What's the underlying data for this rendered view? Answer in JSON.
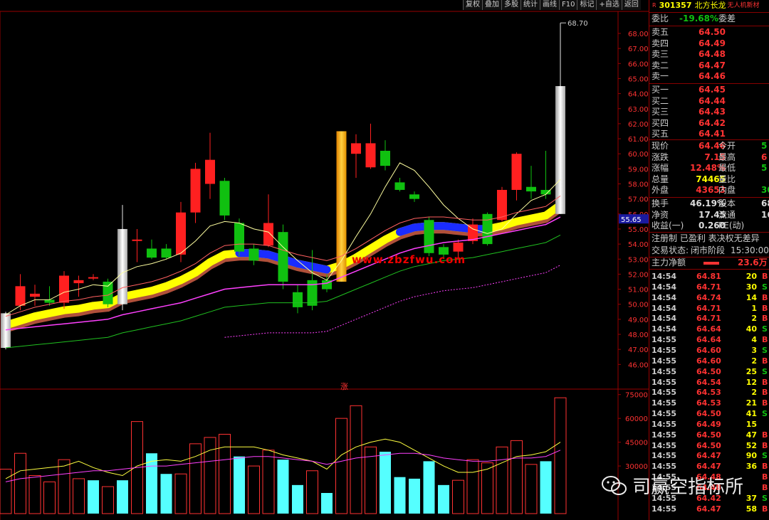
{
  "toolbar": [
    "复权",
    "叠加",
    "多股",
    "统计",
    "画线",
    "F10",
    "标记",
    "+自选",
    "返回"
  ],
  "stock": {
    "tag": "R",
    "code": "301357",
    "name": "北方长龙",
    "industry": "无人机新材"
  },
  "price_axis": {
    "ticks": [
      "68.00",
      "67.00",
      "66.00",
      "65.00",
      "64.00",
      "63.00",
      "62.00",
      "61.00",
      "60.00",
      "59.00",
      "58.00",
      "57.00",
      "56.00",
      "55.00",
      "54.00",
      "53.00",
      "52.00",
      "51.00",
      "50.00",
      "49.00",
      "48.00",
      "47.00",
      "46.00"
    ],
    "current": "55.65",
    "high_label": "68.70"
  },
  "volume_axis": {
    "ticks": [
      "75000",
      "60000",
      "45000",
      "30000"
    ]
  },
  "overlay": {
    "site": "www.zbzfwu.com",
    "limit_up_mark": "涨"
  },
  "watermark": {
    "text": "司赢空指标所"
  },
  "quote": {
    "weibi_label": "委比",
    "weibi_value": "-19.68%",
    "weicha_label": "委差",
    "asks": [
      {
        "label": "卖五",
        "price": "64.50"
      },
      {
        "label": "卖四",
        "price": "64.49"
      },
      {
        "label": "卖三",
        "price": "64.48"
      },
      {
        "label": "卖二",
        "price": "64.47"
      },
      {
        "label": "卖一",
        "price": "64.46"
      }
    ],
    "bids": [
      {
        "label": "买一",
        "price": "64.45"
      },
      {
        "label": "买二",
        "price": "64.44"
      },
      {
        "label": "买三",
        "price": "64.43"
      },
      {
        "label": "买四",
        "price": "64.42"
      },
      {
        "label": "买五",
        "price": "64.41"
      }
    ],
    "stats": [
      {
        "l1": "现价",
        "v1": "64.46",
        "c1": "red",
        "l2": "今开",
        "v2": "5",
        "c2": "green"
      },
      {
        "l1": "涨跌",
        "v1": "7.15",
        "c1": "red",
        "l2": "最高",
        "v2": "6",
        "c2": "red"
      },
      {
        "l1": "涨幅",
        "v1": "12.48%",
        "c1": "red",
        "l2": "最低",
        "v2": "5",
        "c2": "green"
      },
      {
        "l1": "总量",
        "v1": "74465",
        "c1": "yellow",
        "l2": "量比",
        "v2": "",
        "c2": "white"
      },
      {
        "l1": "外盘",
        "v1": "43653",
        "c1": "red",
        "l2": "内盘",
        "v2": "30",
        "c2": "green"
      }
    ],
    "stats2": [
      {
        "l1": "换手",
        "v1": "46.19%",
        "c1": "white",
        "l2": "股本",
        "v2": "68",
        "c2": "white"
      },
      {
        "l1": "净资",
        "v1": "17.45",
        "c1": "white",
        "l2": "流通",
        "v2": "16",
        "c2": "white"
      },
      {
        "l1": "收益(一)",
        "v1": "0.260",
        "c1": "white",
        "l2": "PE(动)",
        "v2": "",
        "c2": "white"
      }
    ],
    "registration": "注册制 已盈利 表决权无差异",
    "trade_status_label": "交易状态:",
    "trade_status": "闭市阶段",
    "trade_time": "15:30:00",
    "main_flow_label": "主力净额",
    "main_flow_value": "23.6万"
  },
  "ticks": [
    {
      "time": "14:54",
      "price": "64.81",
      "vol": "20",
      "dir": "B"
    },
    {
      "time": "14:54",
      "price": "64.71",
      "vol": "30",
      "dir": "S"
    },
    {
      "time": "14:54",
      "price": "64.74",
      "vol": "14",
      "dir": "B"
    },
    {
      "time": "14:54",
      "price": "64.71",
      "vol": "1",
      "dir": "B"
    },
    {
      "time": "14:54",
      "price": "64.71",
      "vol": "2",
      "dir": "B"
    },
    {
      "time": "14:54",
      "price": "64.64",
      "vol": "40",
      "dir": "S"
    },
    {
      "time": "14:55",
      "price": "64.64",
      "vol": "4",
      "dir": "B"
    },
    {
      "time": "14:55",
      "price": "64.60",
      "vol": "3",
      "dir": "S"
    },
    {
      "time": "14:55",
      "price": "64.60",
      "vol": "2",
      "dir": "B"
    },
    {
      "time": "14:55",
      "price": "64.50",
      "vol": "25",
      "dir": "S"
    },
    {
      "time": "14:55",
      "price": "64.54",
      "vol": "12",
      "dir": "B"
    },
    {
      "time": "14:55",
      "price": "64.53",
      "vol": "2",
      "dir": "B"
    },
    {
      "time": "14:55",
      "price": "64.53",
      "vol": "21",
      "dir": "B"
    },
    {
      "time": "14:55",
      "price": "64.50",
      "vol": "41",
      "dir": "S"
    },
    {
      "time": "14:55",
      "price": "64.49",
      "vol": "15",
      "dir": ""
    },
    {
      "time": "14:55",
      "price": "64.50",
      "vol": "47",
      "dir": "B"
    },
    {
      "time": "14:55",
      "price": "64.50",
      "vol": "52",
      "dir": "B"
    },
    {
      "time": "14:55",
      "price": "64.47",
      "vol": "90",
      "dir": "S"
    },
    {
      "time": "14:55",
      "price": "64.47",
      "vol": "36",
      "dir": "B"
    },
    {
      "time": "14:55",
      "price": "64.48",
      "vol": "",
      "dir": "B"
    },
    {
      "time": "14:55",
      "price": "64.48",
      "vol": "",
      "dir": "B"
    },
    {
      "time": "14:55",
      "price": "64.42",
      "vol": "37",
      "dir": "S"
    },
    {
      "time": "14:55",
      "price": "64.47",
      "vol": "58",
      "dir": "B"
    }
  ],
  "colors": {
    "up": "#ff3232",
    "down": "#10c010",
    "volume_cyan": "#55ffff",
    "ma_yellow": "#ffff00",
    "ma_magenta": "#ff40ff",
    "band_blue": "#1a2cff"
  },
  "chart_data": {
    "type": "candlestick",
    "candles": [
      {
        "o": 47.1,
        "c": 49.4,
        "h": 49.5,
        "l": 47.0,
        "color": "white"
      },
      {
        "o": 49.9,
        "c": 51.2,
        "h": 52.0,
        "l": 49.6,
        "color": "red"
      },
      {
        "o": 50.5,
        "c": 50.7,
        "h": 51.3,
        "l": 49.9,
        "color": "red"
      },
      {
        "o": 50.1,
        "c": 50.3,
        "h": 51.2,
        "l": 49.9,
        "color": "green"
      },
      {
        "o": 50.1,
        "c": 51.9,
        "h": 52.2,
        "l": 49.7,
        "color": "red"
      },
      {
        "o": 51.4,
        "c": 51.6,
        "h": 51.9,
        "l": 50.5,
        "color": "red"
      },
      {
        "o": 51.8,
        "c": 51.8,
        "h": 52.0,
        "l": 51.6,
        "color": "red"
      },
      {
        "o": 51.5,
        "c": 50.0,
        "h": 51.7,
        "l": 49.8,
        "color": "green"
      },
      {
        "o": 50.0,
        "c": 55.0,
        "h": 56.6,
        "l": 49.6,
        "color": "white"
      },
      {
        "o": 54.3,
        "c": 54.3,
        "h": 55.0,
        "l": 52.8,
        "color": "red"
      },
      {
        "o": 53.7,
        "c": 53.1,
        "h": 54.3,
        "l": 53.0,
        "color": "green"
      },
      {
        "o": 53.7,
        "c": 53.1,
        "h": 54.0,
        "l": 53.0,
        "color": "green"
      },
      {
        "o": 53.3,
        "c": 56.1,
        "h": 56.8,
        "l": 52.8,
        "color": "red"
      },
      {
        "o": 56.1,
        "c": 59.0,
        "h": 59.4,
        "l": 55.4,
        "color": "red"
      },
      {
        "o": 58.0,
        "c": 59.6,
        "h": 61.4,
        "l": 57.0,
        "color": "red"
      },
      {
        "o": 58.2,
        "c": 55.9,
        "h": 58.4,
        "l": 55.6,
        "color": "green"
      },
      {
        "o": 55.4,
        "c": 53.5,
        "h": 55.7,
        "l": 53.2,
        "color": "green"
      },
      {
        "o": 53.7,
        "c": 52.9,
        "h": 54.0,
        "l": 52.6,
        "color": "green"
      },
      {
        "o": 53.9,
        "c": 55.4,
        "h": 57.3,
        "l": 53.8,
        "color": "red"
      },
      {
        "o": 54.8,
        "c": 51.5,
        "h": 55.3,
        "l": 51.0,
        "color": "green"
      },
      {
        "o": 50.8,
        "c": 49.8,
        "h": 51.3,
        "l": 49.4,
        "color": "green"
      },
      {
        "o": 51.6,
        "c": 49.9,
        "h": 53.6,
        "l": 49.6,
        "color": "green"
      },
      {
        "o": 51.6,
        "c": 51.0,
        "h": 52.0,
        "l": 50.8,
        "color": "green"
      },
      {
        "o": 51.5,
        "c": 61.5,
        "h": 61.5,
        "l": 51.5,
        "color": "orange"
      },
      {
        "o": 60.0,
        "c": 60.7,
        "h": 61.3,
        "l": 58.4,
        "color": "red"
      },
      {
        "o": 59.1,
        "c": 60.7,
        "h": 62.0,
        "l": 59.0,
        "color": "red"
      },
      {
        "o": 60.2,
        "c": 59.2,
        "h": 60.9,
        "l": 58.9,
        "color": "green"
      },
      {
        "o": 57.6,
        "c": 58.1,
        "h": 58.4,
        "l": 57.5,
        "color": "green"
      },
      {
        "o": 57.0,
        "c": 57.3,
        "h": 57.5,
        "l": 56.8,
        "color": "green"
      },
      {
        "o": 55.6,
        "c": 53.4,
        "h": 55.8,
        "l": 53.2,
        "color": "green"
      },
      {
        "o": 53.8,
        "c": 53.3,
        "h": 54.0,
        "l": 53.0,
        "color": "green"
      },
      {
        "o": 53.5,
        "c": 54.1,
        "h": 54.3,
        "l": 53.1,
        "color": "red"
      },
      {
        "o": 54.2,
        "c": 55.3,
        "h": 55.7,
        "l": 54.0,
        "color": "red"
      },
      {
        "o": 56.0,
        "c": 54.0,
        "h": 56.1,
        "l": 53.9,
        "color": "green"
      },
      {
        "o": 55.6,
        "c": 57.6,
        "h": 57.8,
        "l": 55.5,
        "color": "red"
      },
      {
        "o": 57.6,
        "c": 60.0,
        "h": 60.1,
        "l": 56.9,
        "color": "red"
      },
      {
        "o": 57.8,
        "c": 57.5,
        "h": 59.2,
        "l": 57.0,
        "color": "green"
      },
      {
        "o": 57.3,
        "c": 57.6,
        "h": 60.2,
        "l": 57.0,
        "color": "green"
      },
      {
        "o": 56.0,
        "c": 64.5,
        "h": 68.7,
        "l": 56.0,
        "color": "white"
      }
    ],
    "volumes": [
      {
        "v": 28000,
        "color": "red"
      },
      {
        "v": 38000,
        "color": "red"
      },
      {
        "v": 24000,
        "color": "red"
      },
      {
        "v": 20000,
        "color": "red"
      },
      {
        "v": 34000,
        "color": "red"
      },
      {
        "v": 22000,
        "color": "red"
      },
      {
        "v": 21000,
        "color": "cyan"
      },
      {
        "v": 17000,
        "color": "red"
      },
      {
        "v": 21000,
        "color": "cyan"
      },
      {
        "v": 58000,
        "color": "red"
      },
      {
        "v": 38000,
        "color": "cyan"
      },
      {
        "v": 25000,
        "color": "cyan"
      },
      {
        "v": 25000,
        "color": "red"
      },
      {
        "v": 44000,
        "color": "red"
      },
      {
        "v": 48000,
        "color": "red"
      },
      {
        "v": 50000,
        "color": "red"
      },
      {
        "v": 36000,
        "color": "cyan"
      },
      {
        "v": 30000,
        "color": "red"
      },
      {
        "v": 40000,
        "color": "red"
      },
      {
        "v": 34000,
        "color": "cyan"
      },
      {
        "v": 18000,
        "color": "cyan"
      },
      {
        "v": 27000,
        "color": "red"
      },
      {
        "v": 13000,
        "color": "cyan"
      },
      {
        "v": 60000,
        "color": "red"
      },
      {
        "v": 68000,
        "color": "red"
      },
      {
        "v": 42000,
        "color": "red"
      },
      {
        "v": 39000,
        "color": "cyan"
      },
      {
        "v": 23000,
        "color": "cyan"
      },
      {
        "v": 22000,
        "color": "cyan"
      },
      {
        "v": 33000,
        "color": "cyan"
      },
      {
        "v": 18000,
        "color": "cyan"
      },
      {
        "v": 21000,
        "color": "red"
      },
      {
        "v": 34000,
        "color": "red"
      },
      {
        "v": 32000,
        "color": "red"
      },
      {
        "v": 42000,
        "color": "red"
      },
      {
        "v": 46000,
        "color": "red"
      },
      {
        "v": 31000,
        "color": "red"
      },
      {
        "v": 33000,
        "color": "cyan"
      },
      {
        "v": 73000,
        "color": "red"
      }
    ],
    "ma_fast": [
      49.3,
      49.9,
      50.3,
      50.3,
      50.8,
      51.0,
      51.3,
      51.2,
      52.1,
      52.5,
      52.7,
      53.0,
      53.4,
      54.2,
      55.2,
      55.5,
      55.4,
      55.0,
      54.8,
      53.8,
      52.9,
      52.1,
      51.6,
      52.9,
      54.5,
      56.0,
      57.8,
      59.4,
      58.9,
      57.8,
      56.6,
      55.7,
      55.0,
      54.7,
      55.0,
      56.0,
      56.9,
      57.3,
      58.3
    ],
    "ma_slow": [
      48.6,
      48.9,
      49.2,
      49.4,
      49.6,
      49.7,
      49.9,
      50.0,
      50.5,
      50.7,
      50.9,
      51.2,
      51.6,
      52.1,
      52.8,
      53.3,
      53.4,
      53.4,
      53.3,
      53.0,
      52.7,
      52.5,
      52.3,
      52.6,
      53.1,
      53.7,
      54.3,
      54.8,
      55.1,
      55.2,
      55.2,
      55.1,
      55.0,
      55.0,
      55.2,
      55.5,
      55.7,
      55.9,
      56.6
    ],
    "ma_long": [
      48.3,
      48.4,
      48.5,
      48.6,
      48.7,
      48.8,
      48.9,
      49.0,
      49.3,
      49.5,
      49.7,
      49.9,
      50.1,
      50.4,
      50.7,
      51.0,
      51.1,
      51.2,
      51.3,
      51.3,
      51.3,
      51.3,
      51.4,
      51.8,
      52.2,
      52.6,
      53.0,
      53.4,
      53.7,
      53.9,
      54.1,
      54.2,
      54.3,
      54.5,
      54.7,
      54.9,
      55.1,
      55.3,
      55.8
    ],
    "vol_ma5": [
      22000,
      27000,
      28000,
      29000,
      30000,
      33000,
      29000,
      26000,
      24000,
      30000,
      33000,
      34000,
      33000,
      36000,
      40000,
      42000,
      42000,
      42000,
      40000,
      37000,
      35000,
      33000,
      28000,
      37000,
      42000,
      45000,
      47000,
      45000,
      40000,
      35000,
      30000,
      26000,
      26000,
      28000,
      32000,
      36000,
      37000,
      39000,
      45000
    ],
    "vol_ma10": [
      20000,
      22000,
      23000,
      24000,
      25000,
      26000,
      27000,
      27000,
      28000,
      29000,
      30000,
      30000,
      31000,
      32000,
      33000,
      34000,
      35000,
      36000,
      36000,
      35000,
      34000,
      33000,
      31000,
      33000,
      35000,
      36000,
      37000,
      38000,
      38000,
      37000,
      35000,
      34000,
      33000,
      33000,
      34000,
      35000,
      35000,
      36000,
      40000
    ]
  }
}
